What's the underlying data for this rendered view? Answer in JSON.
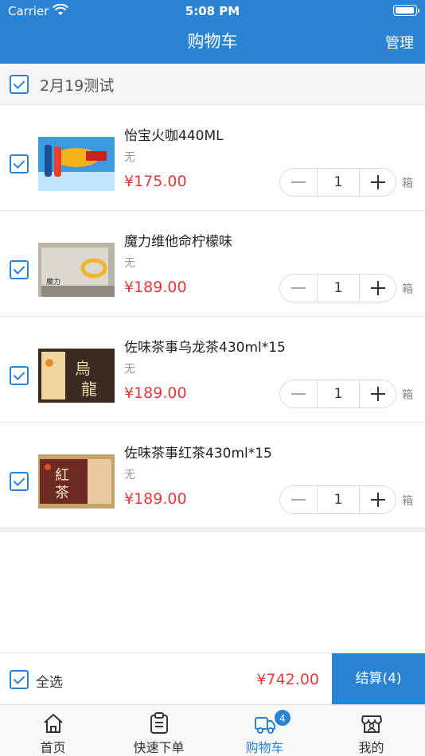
{
  "status_bar": {
    "carrier": "Carrier",
    "time": "5:08 PM"
  },
  "header": {
    "title": "购物车",
    "manage": "管理"
  },
  "group": {
    "title": "2月19测试",
    "checked": true
  },
  "items": [
    {
      "name": "怡宝火咖440ML",
      "spec": "无",
      "price": "¥175.00",
      "qty": "1",
      "unit": "箱",
      "checked": true
    },
    {
      "name": "魔力维他命柠檬味",
      "spec": "无",
      "price": "¥189.00",
      "qty": "1",
      "unit": "箱",
      "checked": true
    },
    {
      "name": "佐味茶事乌龙茶430ml*15",
      "spec": "无",
      "price": "¥189.00",
      "qty": "1",
      "unit": "箱",
      "checked": true
    },
    {
      "name": "佐味茶事红茶430ml*15",
      "spec": "无",
      "price": "¥189.00",
      "qty": "1",
      "unit": "箱",
      "checked": true
    }
  ],
  "thumbnails": {
    "item2_text": "魔力",
    "item3_text_a": "烏",
    "item3_text_b": "龍",
    "item4_text_a": "紅",
    "item4_text_b": "茶"
  },
  "footer": {
    "select_all": "全选",
    "total": "¥742.00",
    "checkout": "结算(4)"
  },
  "tabs": [
    {
      "label": "首页",
      "icon": "home-icon"
    },
    {
      "label": "快速下单",
      "icon": "clipboard-icon"
    },
    {
      "label": "购物车",
      "icon": "truck-icon",
      "badge": "4",
      "active": true
    },
    {
      "label": "我的",
      "icon": "store-user-icon"
    }
  ],
  "colors": {
    "primary": "#2b83d3",
    "price": "#e4393c",
    "background": "#f5f5f5"
  }
}
